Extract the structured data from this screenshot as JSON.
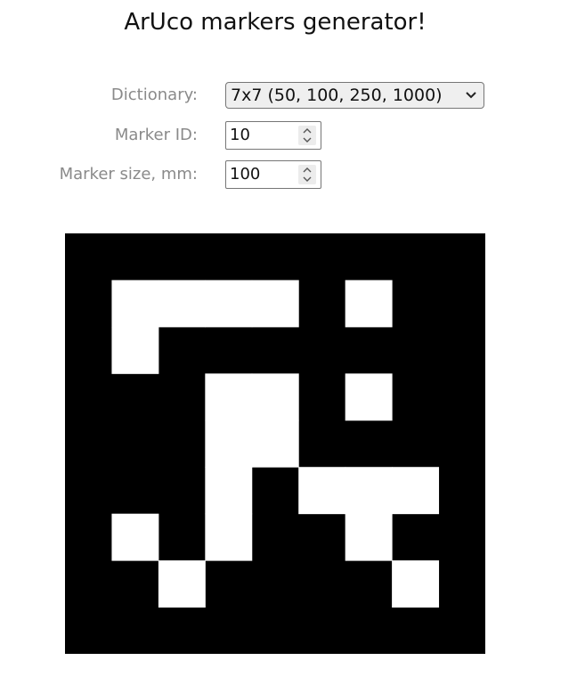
{
  "title": "ArUco markers generator!",
  "form": {
    "dictionary_label": "Dictionary:",
    "dictionary_value": "7x7 (50, 100, 250, 1000)",
    "marker_id_label": "Marker ID:",
    "marker_id_value": "10",
    "marker_size_label": "Marker size, mm:",
    "marker_size_value": "100"
  },
  "marker": {
    "grid": [
      [
        0,
        0,
        0,
        0,
        0,
        0,
        0,
        0,
        0
      ],
      [
        0,
        1,
        1,
        1,
        1,
        0,
        1,
        0,
        0
      ],
      [
        0,
        1,
        0,
        0,
        0,
        0,
        0,
        0,
        0
      ],
      [
        0,
        0,
        0,
        1,
        1,
        0,
        1,
        0,
        0
      ],
      [
        0,
        0,
        0,
        1,
        1,
        0,
        0,
        0,
        0
      ],
      [
        0,
        0,
        0,
        1,
        0,
        1,
        1,
        1,
        0
      ],
      [
        0,
        1,
        0,
        1,
        0,
        0,
        1,
        0,
        0
      ],
      [
        0,
        0,
        1,
        0,
        0,
        0,
        0,
        1,
        0
      ],
      [
        0,
        0,
        0,
        0,
        0,
        0,
        0,
        0,
        0
      ]
    ],
    "colors": {
      "black": "#000000",
      "white": "#ffffff"
    }
  },
  "icons": {
    "dropdown": "chevron-down-icon",
    "spinner_up": "spinner-up-icon",
    "spinner_down": "spinner-down-icon"
  }
}
